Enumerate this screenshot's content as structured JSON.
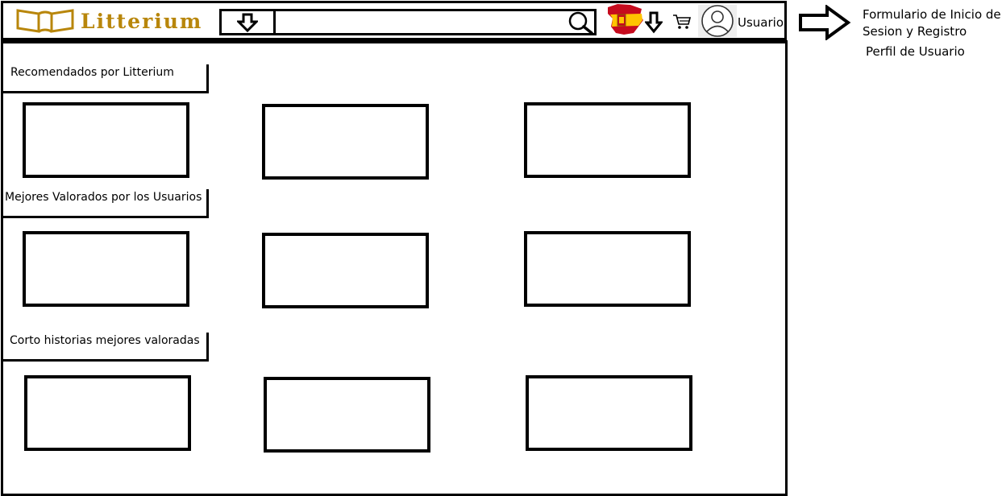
{
  "header": {
    "logo_text": "Litterium",
    "search": {
      "value": "",
      "placeholder": ""
    },
    "user_label": "Usuario",
    "icons": [
      "book-logo-icon",
      "arrow-down-icon",
      "search-icon",
      "spain-flag-icon",
      "arrow-down-icon",
      "cart-icon",
      "user-avatar-icon"
    ]
  },
  "annotation": {
    "line1": "Formulario de Inicio de Sesion y Registro",
    "line2": "Perfil de Usuario",
    "icon": "arrow-right-icon"
  },
  "sections": [
    {
      "title": "Recomendados por Litterium",
      "cards": 3
    },
    {
      "title": "Mejores Valorados por los Usuarios",
      "cards": 3
    },
    {
      "title": "Corto historias mejores valoradas",
      "cards": 3
    }
  ],
  "colors": {
    "logo": "#b8860b",
    "stroke": "#000000",
    "flag_red": "#c60b1e",
    "flag_yellow": "#ffc400"
  }
}
